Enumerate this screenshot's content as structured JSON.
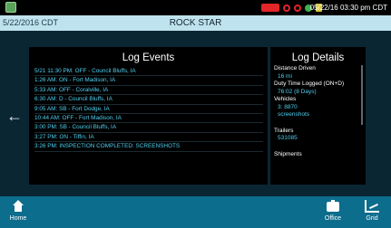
{
  "status": {
    "time": "05/22/16 03:30 pm CDT"
  },
  "header": {
    "date": "5/22/2016 CDT",
    "driver_name": "ROCK STAR"
  },
  "events": {
    "title": "Log Events",
    "items": [
      "5/21 11:30 PM: OFF - Council Bluffs, IA",
      "1:26 AM: ON - Fort Madison, IA",
      "5:33 AM: OFF - Coralville, IA",
      "6:30 AM: D - Council Bluffs, IA",
      "9:05 AM: SB - Fort Dodge, IA",
      "10:44 AM: OFF - Fort Madison, IA",
      "3:00 PM: SB - Council Bluffs, IA",
      "3:27 PM: ON - Tiffin, IA",
      "3:26 PM: INSPECTION COMPLETED: SCREENSHOTS"
    ]
  },
  "details": {
    "title": "Log Details",
    "distance_label": "Distance Driven",
    "distance_value": "16 mi",
    "duty_label": "Duty Time Logged (ON+D)",
    "duty_value": "76:02 (8 Days)",
    "vehicles_label": "Vehicles",
    "vehicle_1": "3: 8870",
    "vehicle_2": "screenshots",
    "trailers_label": "Trailers",
    "trailer_1": "531085",
    "shipments_label": "Shipments"
  },
  "nav": {
    "home": "Home",
    "office": "Office",
    "grid": "Grid"
  },
  "colors": {
    "accent": "#0c6d8d",
    "event_text": "#4fd0f0",
    "status_red": "#e2262a"
  }
}
